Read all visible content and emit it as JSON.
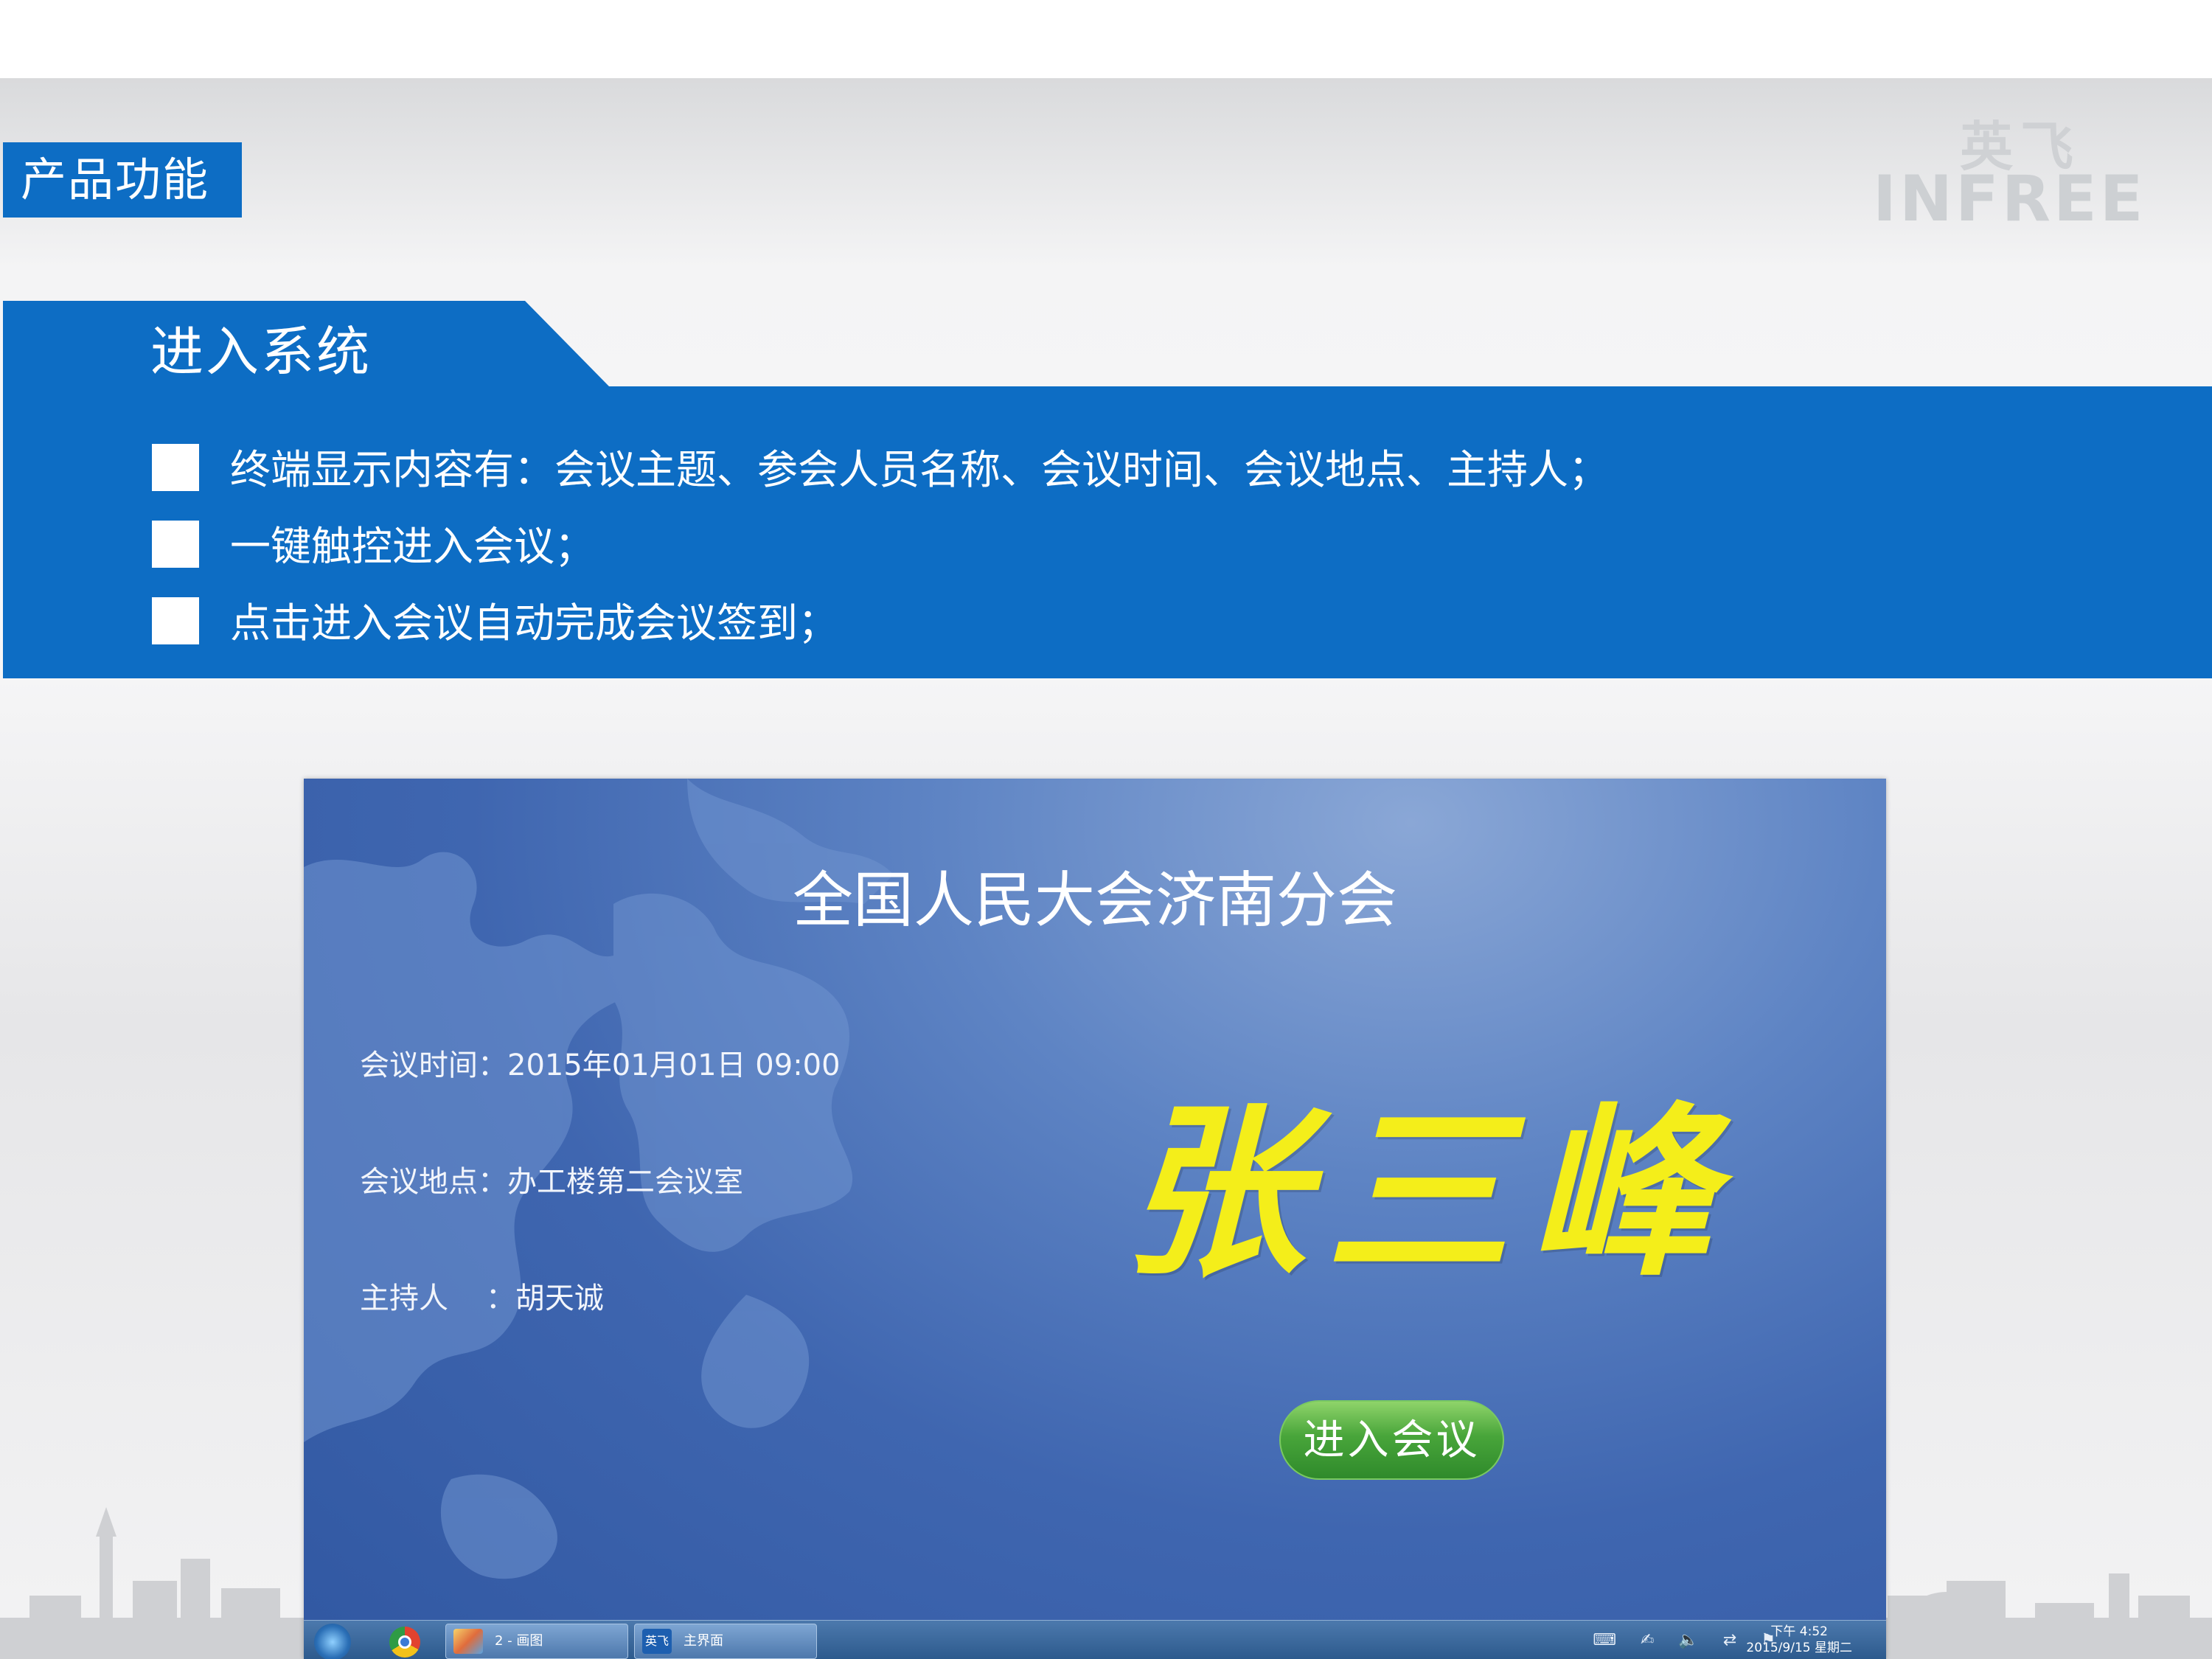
{
  "section_tag": "产品功能",
  "logo": {
    "cn": "英飞",
    "en": "INFREE"
  },
  "banner": {
    "title": "进入系统",
    "bullets": [
      "终端显示内容有：会议主题、参会人员名称、会议时间、会议地点、主持人；",
      "一键触控进入会议；",
      "点击进入会议自动完成会议签到；"
    ]
  },
  "screen": {
    "meeting_title": "全国人民大会济南分会",
    "time_line": "会议时间：2015年01月01日 09:00",
    "location_line": "会议地点：办工楼第二会议室",
    "host_line": "主持人    ：胡天诚",
    "attendee_name": "张三峰",
    "enter_button": "进入会议",
    "taskbar": {
      "tasks": [
        "2 - 画图",
        "主界面"
      ],
      "task_icon_label": "英飞",
      "clock_time": "下午 4:52",
      "clock_date": "2015/9/15 星期二"
    }
  },
  "colors": {
    "brand_blue": "#0d6dc4",
    "name_yellow": "#f4ee1a",
    "button_green": "#48a53a"
  }
}
